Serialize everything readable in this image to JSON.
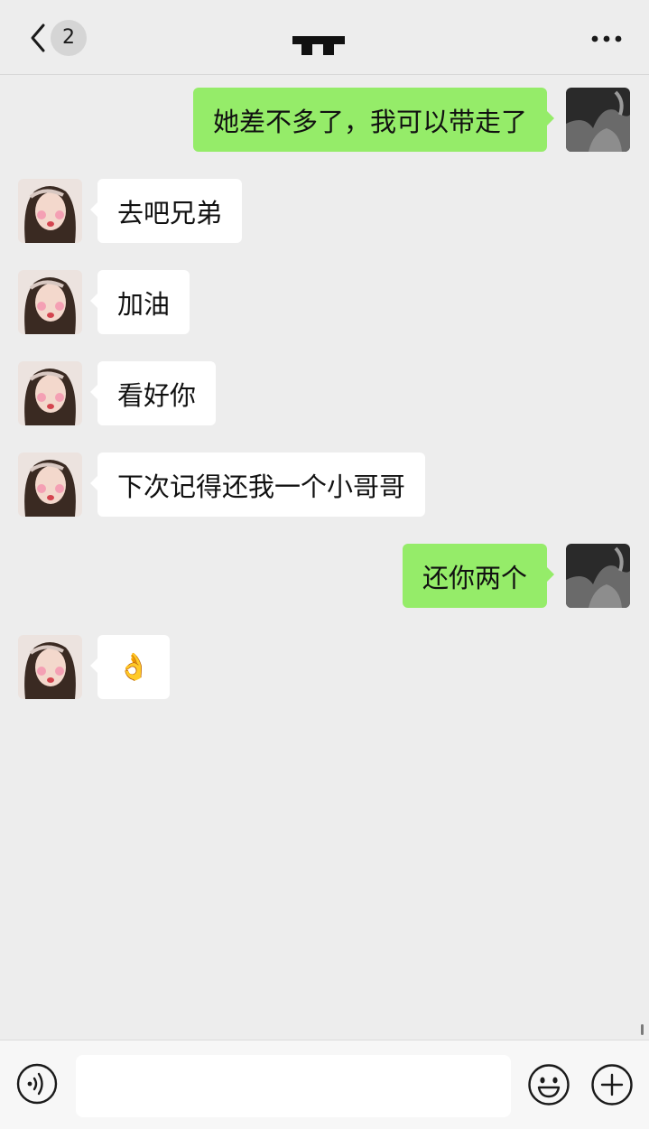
{
  "header": {
    "back_badge": "2",
    "title_redacted": "redacted-contact-name",
    "more_icon": "more-dots-icon"
  },
  "messages": [
    {
      "side": "out",
      "text": "她差不多了，我可以带走了",
      "avatar": "self-avatar"
    },
    {
      "side": "in",
      "text": "去吧兄弟",
      "avatar": "contact-avatar"
    },
    {
      "side": "in",
      "text": "加油",
      "avatar": "contact-avatar"
    },
    {
      "side": "in",
      "text": "看好你",
      "avatar": "contact-avatar"
    },
    {
      "side": "in",
      "text": "下次记得还我一个小哥哥",
      "avatar": "contact-avatar"
    },
    {
      "side": "out",
      "text": "还你两个",
      "avatar": "self-avatar"
    },
    {
      "side": "in",
      "text": "👌",
      "avatar": "contact-avatar"
    }
  ],
  "input_bar": {
    "voice_icon": "voice-icon",
    "text_value": "",
    "emoji_icon": "emoji-icon",
    "plus_icon": "plus-icon"
  },
  "colors": {
    "background": "#ededed",
    "outgoing_bubble": "#95ec69",
    "incoming_bubble": "#ffffff"
  }
}
